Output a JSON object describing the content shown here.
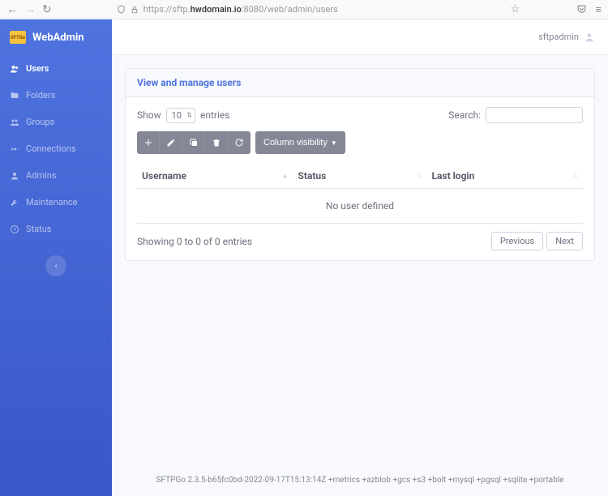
{
  "browser": {
    "url_prefix": "https://sftp.",
    "url_domain": "hwdomain.io",
    "url_suffix": ":8080/web/admin/users"
  },
  "brand": {
    "logo_text": "SFTGo",
    "name": "WebAdmin"
  },
  "nav": {
    "users": "Users",
    "folders": "Folders",
    "groups": "Groups",
    "connections": "Connections",
    "admins": "Admins",
    "maintenance": "Maintenance",
    "status": "Status"
  },
  "topbar": {
    "username": "sftpadmin"
  },
  "card": {
    "title": "View and manage users"
  },
  "table": {
    "show_label": "Show",
    "entries_label": "entries",
    "entries_value": "10",
    "search_label": "Search:",
    "col_vis": "Column visibility",
    "headers": {
      "username": "Username",
      "status": "Status",
      "last_login": "Last login"
    },
    "empty": "No user defined",
    "info": "Showing 0 to 0 of 0 entries",
    "prev": "Previous",
    "next": "Next"
  },
  "footer": "SFTPGo 2.3.5-b65fc0bd-2022-09-17T15:13:14Z +metrics +azblob +gcs +s3 +bolt +mysql +pgsql +sqlite +portable"
}
